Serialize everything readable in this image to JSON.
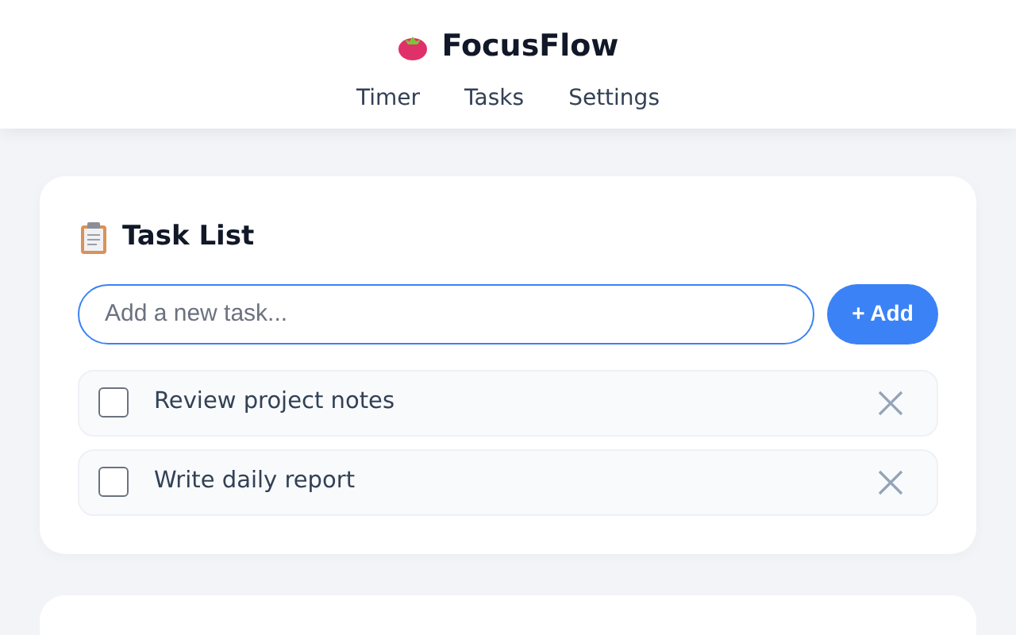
{
  "app": {
    "title": "FocusFlow"
  },
  "nav": [
    {
      "label": "Timer",
      "selected": false
    },
    {
      "label": "Tasks",
      "selected": false
    },
    {
      "label": "Settings",
      "selected": false
    }
  ],
  "task_list": {
    "title": "Task List",
    "input": {
      "placeholder": "Add a new task..."
    },
    "add_button": "+ Add",
    "tasks": [
      {
        "text": "Review project notes",
        "checked": false
      },
      {
        "text": "Write daily report",
        "checked": false
      }
    ]
  }
}
